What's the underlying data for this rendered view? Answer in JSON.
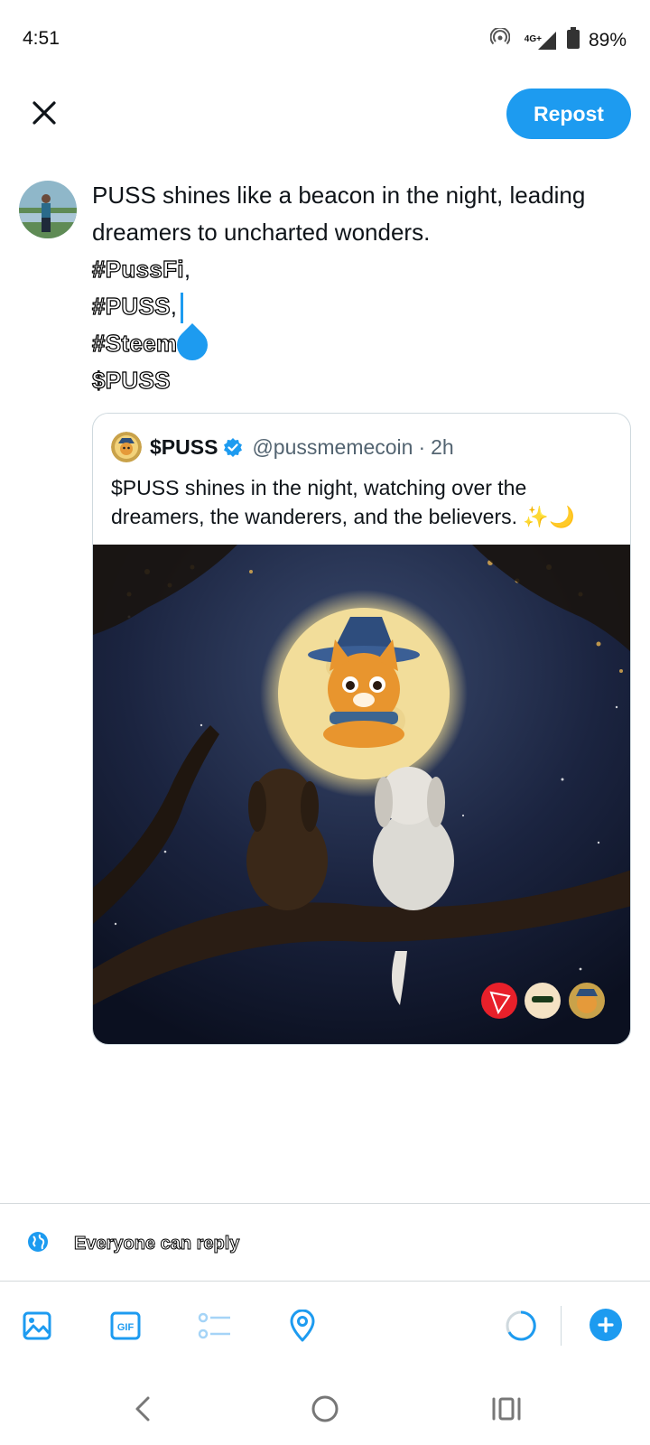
{
  "status_bar": {
    "time": "4:51",
    "network": "4G+",
    "battery": "89%"
  },
  "top_bar": {
    "close_icon": "close-icon",
    "repost_label": "Repost"
  },
  "composer": {
    "text_line1": "PUSS shines like a beacon in the night, leading dreamers to uncharted wonders.",
    "tag1": "#PussFi",
    "tag1_suffix": ",",
    "tag2": "#PUSS",
    "tag2_suffix": ",",
    "tag3": "#Steem",
    "tag4": "$PUSS"
  },
  "quote": {
    "name": "$PUSS",
    "handle": "@pussmemecoin",
    "separator": "·",
    "time": "2h",
    "text": "$PUSS shines in the night, watching over the dreamers, the wanderers, and the believers. ✨🌙",
    "verified_icon": "verified-icon"
  },
  "reply_settings": {
    "label": "Everyone can reply",
    "icon": "globe-icon"
  },
  "toolbar": {
    "items": [
      "image-icon",
      "gif-icon",
      "poll-icon",
      "location-icon"
    ],
    "gif_label": "GIF"
  },
  "nav": {
    "items": [
      "back-icon",
      "home-icon",
      "recents-icon"
    ]
  },
  "colors": {
    "accent": "#1d9bf0",
    "text": "#0f1419",
    "muted": "#536471",
    "border": "#cfd9de"
  }
}
